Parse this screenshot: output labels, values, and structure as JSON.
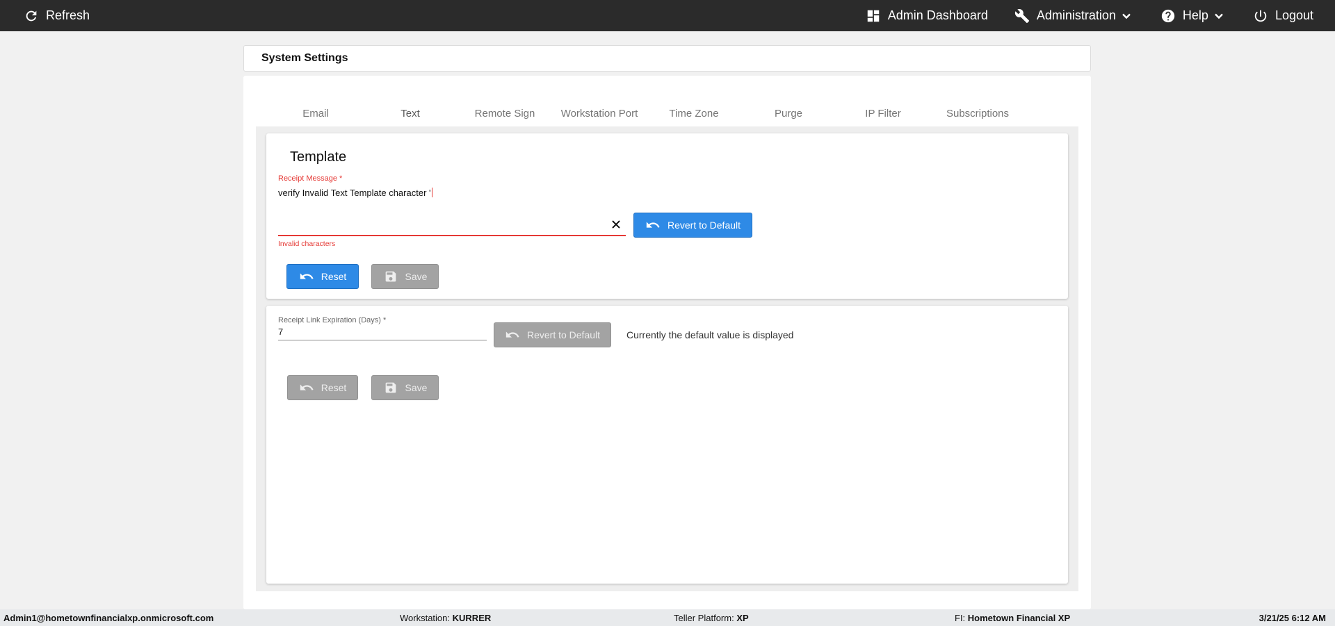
{
  "topbar": {
    "refresh_label": "Refresh",
    "dashboard_label": "Admin Dashboard",
    "administration_label": "Administration",
    "help_label": "Help",
    "logout_label": "Logout"
  },
  "header": {
    "title": "System Settings"
  },
  "tabs": [
    {
      "label": "Email"
    },
    {
      "label": "Text"
    },
    {
      "label": "Remote Sign"
    },
    {
      "label": "Workstation Port"
    },
    {
      "label": "Time Zone"
    },
    {
      "label": "Purge"
    },
    {
      "label": "IP Filter"
    },
    {
      "label": "Subscriptions"
    }
  ],
  "active_tab": "Text",
  "template_panel": {
    "heading": "Template",
    "field_label": "Receipt Message *",
    "field_value": "verify Invalid Text Template character '",
    "error_message": "Invalid characters",
    "revert_label": "Revert to Default",
    "reset_label": "Reset",
    "save_label": "Save"
  },
  "expiration_panel": {
    "field_label": "Receipt Link Expiration (Days) *",
    "field_value": "7",
    "revert_label": "Revert to Default",
    "info_text": "Currently the default value is displayed",
    "reset_label": "Reset",
    "save_label": "Save"
  },
  "footer": {
    "user": "Admin1@hometownfinancialxp.onmicrosoft.com",
    "workstation_label": "Workstation:",
    "workstation_value": "KURRER",
    "platform_label": "Teller Platform:",
    "platform_value": "XP",
    "fi_label": "FI:",
    "fi_value": "Hometown Financial XP",
    "datetime": "3/21/25 6:12 AM"
  },
  "colors": {
    "topbar": "#2b2b2b",
    "primary_button": "#2e8ae6",
    "disabled_button": "#a3a3a3",
    "error": "#e53935",
    "tab_indicator": "#3f51b5"
  }
}
